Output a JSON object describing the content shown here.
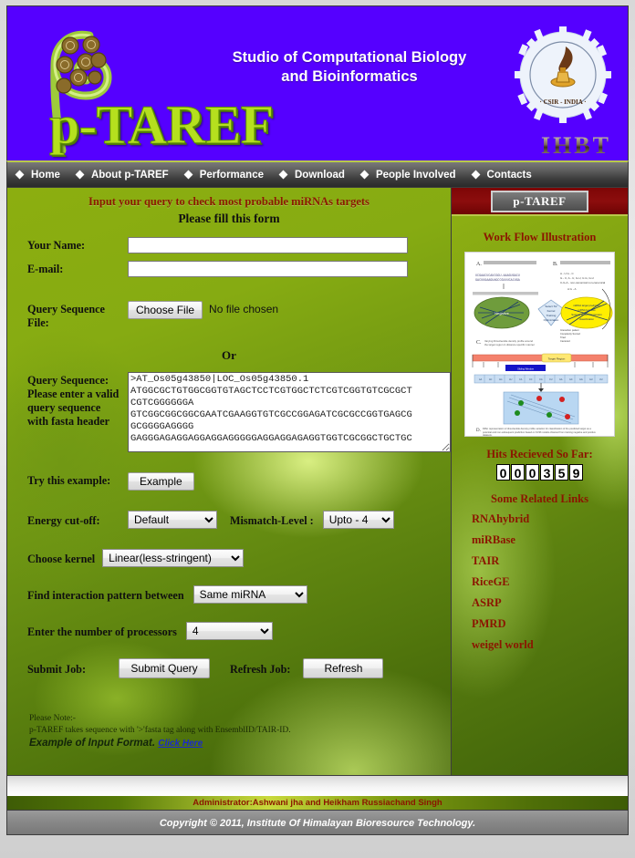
{
  "header": {
    "logo_text": "p-TAREF",
    "title_line1": "Studio of Computational Biology",
    "title_line2": "and Bioinformatics",
    "institute_abbr": "IHBT",
    "csir_caption": "CSIR - INDIA"
  },
  "nav": {
    "items": [
      {
        "label": "Home",
        "name": "nav-home"
      },
      {
        "label": "About p-TAREF",
        "name": "nav-about-p-taref"
      },
      {
        "label": "Performance",
        "name": "nav-performance"
      },
      {
        "label": "Download",
        "name": "nav-download"
      },
      {
        "label": "People Involved",
        "name": "nav-people-involved"
      },
      {
        "label": "Contacts",
        "name": "nav-contacts"
      }
    ]
  },
  "form": {
    "heading": "Input your query to check most probable miRNAs targets",
    "subheading": "Please fill this form",
    "name_label": "Your Name:",
    "name_value": "",
    "email_label": "E-mail:",
    "email_value": "",
    "file_label_line1": "Query Sequence",
    "file_label_line2": "File:",
    "choose_file_label": "Choose File",
    "no_file_text": "No file chosen",
    "or_text": "Or",
    "sequence_label_line1": "Query Sequence:",
    "sequence_label_line2": "Please enter a valid",
    "sequence_label_line3": "query sequence",
    "sequence_label_line4": "with fasta header",
    "sequence_value": ">AT_Os05g43850|LOC_Os05g43850.1\nATGGCGCTGTGGCGGTGTAGCTCCTCGTGGCTCTCGTCGGTGTCGCGCT\nCGTCGGGGGGA\nGTCGGCGGCGGCGAATCGAAGGTGTCGCCGGAGATCGCGCCGGTGAGCG\nGCGGGGAGGGG\nGAGGGAGAGGAGGAGGAGGGGGAGGAGGAGAGGTGGTCGCGGCTGCTGC",
    "example_label": "Try this example:",
    "example_button": "Example",
    "energy_label": "Energy cut-off:",
    "energy_value": "Default",
    "energy_options": [
      "Default"
    ],
    "mismatch_label": "Mismatch-Level :",
    "mismatch_value": "Upto - 4",
    "mismatch_options": [
      "Upto - 4"
    ],
    "kernel_label": "Choose kernel",
    "kernel_value": "Linear(less-stringent)",
    "kernel_options": [
      "Linear(less-stringent)"
    ],
    "interaction_label": "Find interaction pattern between",
    "interaction_value": "Same miRNA",
    "interaction_options": [
      "Same miRNA"
    ],
    "processors_label": "Enter the number of processors",
    "processors_value": "4",
    "processors_options": [
      "4"
    ],
    "submit_label": "Submit Job:",
    "submit_button": "Submit Query",
    "refresh_label": "Refresh Job:",
    "refresh_button": "Refresh",
    "note_line1": "Please Note:-",
    "note_line2": "p-TAREF takes sequence with '>'fasta tag along with EnsemblID/TAIR-ID.",
    "note_line3": "Example of Input Format.",
    "note_link": "Click Here"
  },
  "sidebar": {
    "panel_title": "p-TAREF",
    "workflow_title": "Work Flow Illustration",
    "workflow_panels": [
      "A",
      "B",
      "C",
      "D"
    ],
    "hits_title": "Hits Recieved So Far:",
    "hits_count": "000359",
    "hits_digits": [
      "0",
      "0",
      "0",
      "3",
      "5",
      "9"
    ],
    "links_title": "Some Related Links",
    "links": [
      {
        "label": "RNAhybrid",
        "name": "link-rnahybrid"
      },
      {
        "label": "miRBase",
        "name": "link-mirbase"
      },
      {
        "label": "TAIR",
        "name": "link-tair"
      },
      {
        "label": "RiceGE",
        "name": "link-ricege"
      },
      {
        "label": "ASRP",
        "name": "link-asrp"
      },
      {
        "label": "PMRD",
        "name": "link-pmrd"
      },
      {
        "label": "weigel world",
        "name": "link-weigel-world"
      }
    ]
  },
  "footer": {
    "administrator": "Administrator:Ashwani jha and Heikham Russiachand Singh",
    "copyright": "Copyright © 2011, Institute Of Himalayan Bioresource Technology."
  },
  "colors": {
    "banner_purple": "#5500ff",
    "logo_green": "#b5e01e",
    "form_green": "#8cae10",
    "sidebar_header_red": "#8c0d0d",
    "heading_red": "#8b1500",
    "nav_gray": "#3a3a3a",
    "link_blue": "#1a2acc"
  }
}
